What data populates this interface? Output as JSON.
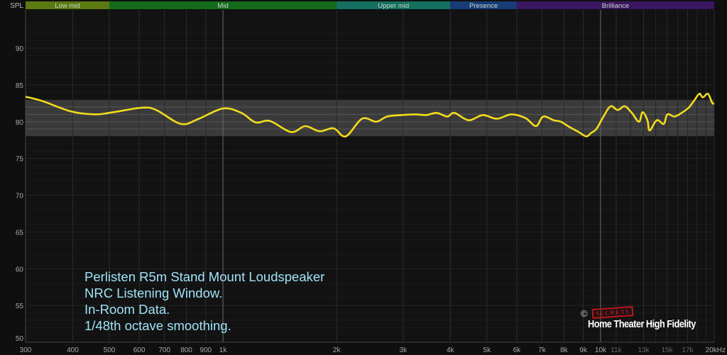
{
  "chart_data": {
    "type": "line",
    "title": "",
    "ylabel": "SPL",
    "xlabel": "",
    "xscale": "log",
    "xlim": [
      300,
      20000
    ],
    "ylim": [
      50,
      94
    ],
    "grid": true,
    "y_ticks": [
      50,
      55,
      60,
      65,
      70,
      75,
      80,
      85,
      90
    ],
    "y_tick_labels": [
      "50",
      "55",
      "60",
      "65",
      "70",
      "75",
      "80",
      "85",
      "90"
    ],
    "x_ticks": [
      300,
      400,
      500,
      600,
      700,
      800,
      900,
      1000,
      2000,
      3000,
      4000,
      5000,
      6000,
      7000,
      8000,
      9000,
      10000,
      11000,
      13000,
      15000,
      17000,
      20000
    ],
    "x_tick_labels": [
      "300",
      "400",
      "500",
      "600",
      "700",
      "800",
      "900",
      "1k",
      "2k",
      "3k",
      "4k",
      "5k",
      "6k",
      "7k",
      "8k",
      "9k",
      "10k",
      "11k",
      "13k",
      "15k",
      "17k",
      "20kHz"
    ],
    "target_band": [
      78,
      83
    ],
    "bands": [
      {
        "label": "Low mid",
        "from": 300,
        "to": 500,
        "color": "#5b7a12"
      },
      {
        "label": "Mid",
        "from": 500,
        "to": 2000,
        "color": "#156b1c"
      },
      {
        "label": "Upper mid",
        "from": 2000,
        "to": 4000,
        "color": "#14705f"
      },
      {
        "label": "Presence",
        "from": 4000,
        "to": 6000,
        "color": "#173c78"
      },
      {
        "label": "Brilliance",
        "from": 6000,
        "to": 20000,
        "color": "#3a1560"
      }
    ],
    "series": [
      {
        "name": "NRC Listening Window",
        "color": "#f3dc1c",
        "x": [
          300,
          333,
          396,
          460,
          513,
          610,
          665,
          774,
          863,
          1000,
          1119,
          1220,
          1331,
          1515,
          1652,
          1801,
          1964,
          2114,
          2335,
          2547,
          2719,
          2964,
          3232,
          3448,
          3680,
          3927,
          4102,
          4474,
          4876,
          5317,
          5797,
          6323,
          6746,
          7047,
          7516,
          7852,
          8199,
          8745,
          9171,
          9452,
          9749,
          10180,
          10630,
          11100,
          11590,
          12100,
          12640,
          12920,
          13310,
          13490,
          14090,
          14710,
          15030,
          15690,
          16390,
          17110,
          17710,
          18270,
          18660,
          19240,
          19740,
          20000
        ],
        "y": [
          83.4,
          82.8,
          81.4,
          81.0,
          81.3,
          81.9,
          81.6,
          79.7,
          80.4,
          81.8,
          81.2,
          79.9,
          80.1,
          78.6,
          79.4,
          78.7,
          79.1,
          78.0,
          80.4,
          80.0,
          80.7,
          80.9,
          81.0,
          80.9,
          81.2,
          80.7,
          81.2,
          80.2,
          80.9,
          80.4,
          81.0,
          80.5,
          79.4,
          80.7,
          80.2,
          80.0,
          79.4,
          78.6,
          78.0,
          78.5,
          79.0,
          80.7,
          82.1,
          81.6,
          82.1,
          81.2,
          80.0,
          81.3,
          80.2,
          78.8,
          80.2,
          79.7,
          81.0,
          80.7,
          81.2,
          81.9,
          82.9,
          83.8,
          83.3,
          83.8,
          82.6,
          82.4
        ]
      }
    ],
    "annotations": [
      "Perlisten R5m Stand Mount Loudspeaker",
      "NRC Listening Window.",
      "In-Room Data.",
      "1/48th octave smoothing."
    ],
    "watermark": {
      "copyright": "©",
      "secrets": "SECRETS",
      "text": "Home Theater High Fidelity"
    }
  }
}
